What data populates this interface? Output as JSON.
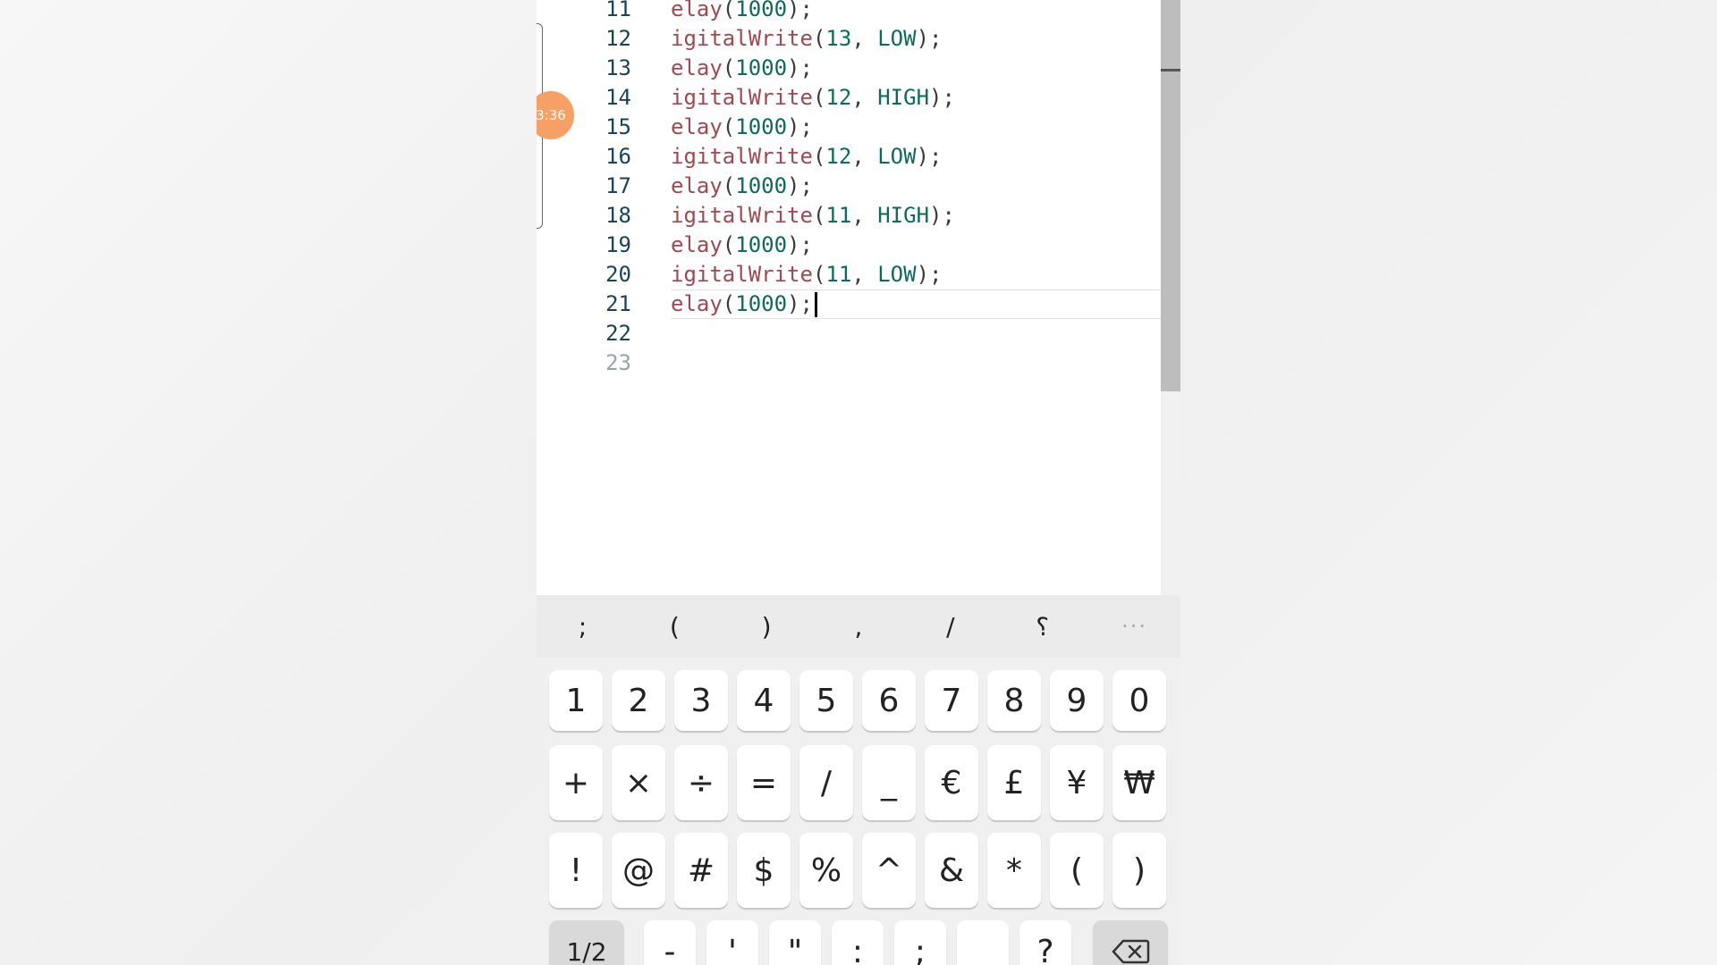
{
  "editor": {
    "lines": [
      {
        "num": "11",
        "tokens": [
          [
            "fn",
            "elay"
          ],
          [
            "pun",
            "("
          ],
          [
            "num",
            "1000"
          ],
          [
            "pun",
            ");"
          ]
        ]
      },
      {
        "num": "12",
        "tokens": [
          [
            "fn",
            "igitalWrite"
          ],
          [
            "pun",
            "("
          ],
          [
            "num",
            "13"
          ],
          [
            "pun",
            ", "
          ],
          [
            "kw",
            "LOW"
          ],
          [
            "pun",
            ");"
          ]
        ]
      },
      {
        "num": "13",
        "tokens": [
          [
            "fn",
            "elay"
          ],
          [
            "pun",
            "("
          ],
          [
            "num",
            "1000"
          ],
          [
            "pun",
            ");"
          ]
        ]
      },
      {
        "num": "14",
        "tokens": [
          [
            "fn",
            "igitalWrite"
          ],
          [
            "pun",
            "("
          ],
          [
            "num",
            "12"
          ],
          [
            "pun",
            ", "
          ],
          [
            "kw",
            "HIGH"
          ],
          [
            "pun",
            ");"
          ]
        ]
      },
      {
        "num": "15",
        "tokens": [
          [
            "fn",
            "elay"
          ],
          [
            "pun",
            "("
          ],
          [
            "num",
            "1000"
          ],
          [
            "pun",
            ");"
          ]
        ]
      },
      {
        "num": "16",
        "tokens": [
          [
            "fn",
            "igitalWrite"
          ],
          [
            "pun",
            "("
          ],
          [
            "num",
            "12"
          ],
          [
            "pun",
            ", "
          ],
          [
            "kw",
            "LOW"
          ],
          [
            "pun",
            ");"
          ]
        ]
      },
      {
        "num": "17",
        "tokens": [
          [
            "fn",
            "elay"
          ],
          [
            "pun",
            "("
          ],
          [
            "num",
            "1000"
          ],
          [
            "pun",
            ");"
          ]
        ]
      },
      {
        "num": "18",
        "tokens": [
          [
            "fn",
            "igitalWrite"
          ],
          [
            "pun",
            "("
          ],
          [
            "num",
            "11"
          ],
          [
            "pun",
            ", "
          ],
          [
            "kw",
            "HIGH"
          ],
          [
            "pun",
            ");"
          ]
        ]
      },
      {
        "num": "19",
        "tokens": [
          [
            "fn",
            "elay"
          ],
          [
            "pun",
            "("
          ],
          [
            "num",
            "1000"
          ],
          [
            "pun",
            ");"
          ]
        ]
      },
      {
        "num": "20",
        "tokens": [
          [
            "fn",
            "igitalWrite"
          ],
          [
            "pun",
            "("
          ],
          [
            "num",
            "11"
          ],
          [
            "pun",
            ", "
          ],
          [
            "kw",
            "LOW"
          ],
          [
            "pun",
            ");"
          ]
        ]
      },
      {
        "num": "21",
        "tokens": [
          [
            "fn",
            "elay"
          ],
          [
            "pun",
            "("
          ],
          [
            "num",
            "1000"
          ],
          [
            "pun",
            ");"
          ]
        ],
        "current": true
      },
      {
        "num": "22",
        "tokens": []
      },
      {
        "num": "23",
        "tokens": [],
        "dim": true
      }
    ]
  },
  "timer_bubble": "3:36",
  "keyboard": {
    "suggestions": [
      ";",
      "(",
      ")",
      ",",
      "/",
      "؟",
      "···"
    ],
    "rows": [
      [
        "1",
        "2",
        "3",
        "4",
        "5",
        "6",
        "7",
        "8",
        "9",
        "0"
      ],
      [
        "+",
        "×",
        "÷",
        "=",
        "/",
        "_",
        "€",
        "£",
        "¥",
        "₩"
      ],
      [
        "!",
        "@",
        "#",
        "$",
        "%",
        "^",
        "&",
        "*",
        "(",
        ")"
      ],
      [
        "1/2",
        "-",
        "'",
        "\"",
        ":",
        ";",
        " ",
        "?",
        "backspace"
      ]
    ]
  },
  "colors": {
    "function": "#a0494f",
    "number": "#0c6b5c",
    "line_number": "#17455c",
    "timer_bubble": "#f6a065"
  }
}
